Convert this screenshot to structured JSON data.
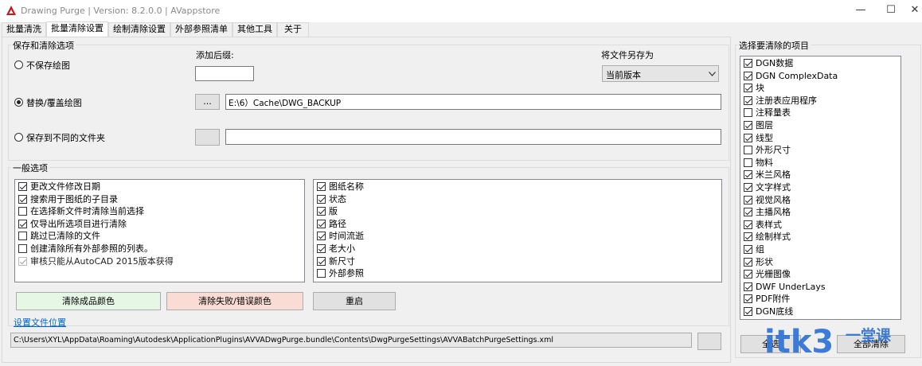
{
  "window": {
    "title": "Drawing Purge | Version: 8.2.0.0  |  AVappstore",
    "minimize": "—",
    "maximize": "☐",
    "close": "✕"
  },
  "tabs": [
    "批量清洗",
    "批量清除设置",
    "绘制清除设置",
    "外部参照清单",
    "其他工具",
    "关于"
  ],
  "save_group": {
    "label": "保存和清除选项",
    "suffix_label": "添加后缀:",
    "suffix_value": "",
    "save_as_label": "将文件另存为",
    "save_as_value": "当前版本",
    "radio_no_save": "不保存绘图",
    "radio_overwrite": "替换/覆盖绘图",
    "radio_other_folder": "保存到不同的文件夹",
    "browse_label": "...",
    "backup_path": "E:\\6）Cache\\DWG_BACKUP",
    "other_folder_path": ""
  },
  "general_group": {
    "label": "一般选项",
    "left_options": [
      {
        "label": "更改文件修改日期",
        "checked": true
      },
      {
        "label": "搜索用于图纸的子目录",
        "checked": true
      },
      {
        "label": "在选择新文件时清除当前选择",
        "checked": false
      },
      {
        "label": "仅导出所选项目进行清除",
        "checked": true
      },
      {
        "label": "跳过已清除的文件",
        "checked": false
      },
      {
        "label": "创建清除所有外部参照的列表。",
        "checked": false
      },
      {
        "label": "审核只能从AutoCAD 2015版本获得",
        "checked": true,
        "disabled": true
      }
    ],
    "right_options": [
      {
        "label": "图纸名称",
        "checked": true
      },
      {
        "label": "状态",
        "checked": true
      },
      {
        "label": "版",
        "checked": true
      },
      {
        "label": "路径",
        "checked": true
      },
      {
        "label": "时间流逝",
        "checked": true
      },
      {
        "label": "老大小",
        "checked": true
      },
      {
        "label": "新尺寸",
        "checked": true
      },
      {
        "label": "外部参照",
        "checked": false
      }
    ]
  },
  "buttons": {
    "success_color": "清除成品颜色",
    "fail_color": "清除失败/错误颜色",
    "restart": "重启",
    "success_bg": "#e6f7e6",
    "fail_bg": "#f9dcd4"
  },
  "settings": {
    "link": "设置文件位置",
    "path": "C:\\Users\\XYL\\AppData\\Roaming\\Autodesk\\ApplicationPlugins\\AVVADwgPurge.bundle\\Contents\\DwgPurgeSettings\\AVVABatchPurgeSettings.xml"
  },
  "items_group": {
    "label": "选择要清除的项目",
    "items": [
      {
        "label": "DGN数据",
        "checked": true
      },
      {
        "label": "DGN ComplexData",
        "checked": true
      },
      {
        "label": "块",
        "checked": true
      },
      {
        "label": "注册表应用程序",
        "checked": true
      },
      {
        "label": "注释量表",
        "checked": false
      },
      {
        "label": "图层",
        "checked": true
      },
      {
        "label": "线型",
        "checked": true
      },
      {
        "label": "外形尺寸",
        "checked": false
      },
      {
        "label": "物料",
        "checked": false
      },
      {
        "label": "米兰风格",
        "checked": true
      },
      {
        "label": "文字样式",
        "checked": true
      },
      {
        "label": "视觉风格",
        "checked": true
      },
      {
        "label": "主播风格",
        "checked": true
      },
      {
        "label": "表样式",
        "checked": true
      },
      {
        "label": "绘制样式",
        "checked": true
      },
      {
        "label": "组",
        "checked": true
      },
      {
        "label": "形状",
        "checked": true
      },
      {
        "label": "光栅图像",
        "checked": true
      },
      {
        "label": "DWF UnderLays",
        "checked": true
      },
      {
        "label": "PDF附件",
        "checked": true
      },
      {
        "label": "DGN底线",
        "checked": true
      }
    ],
    "select_all": "全选",
    "clear_all": "全部清除"
  },
  "watermark": {
    "text_itk3": "itk3",
    "text_cn": "一堂课"
  },
  "colors": {
    "accent_red": "#c8161d",
    "link_blue": "#0066cc",
    "watermark_blue": "#2a6fd6"
  }
}
